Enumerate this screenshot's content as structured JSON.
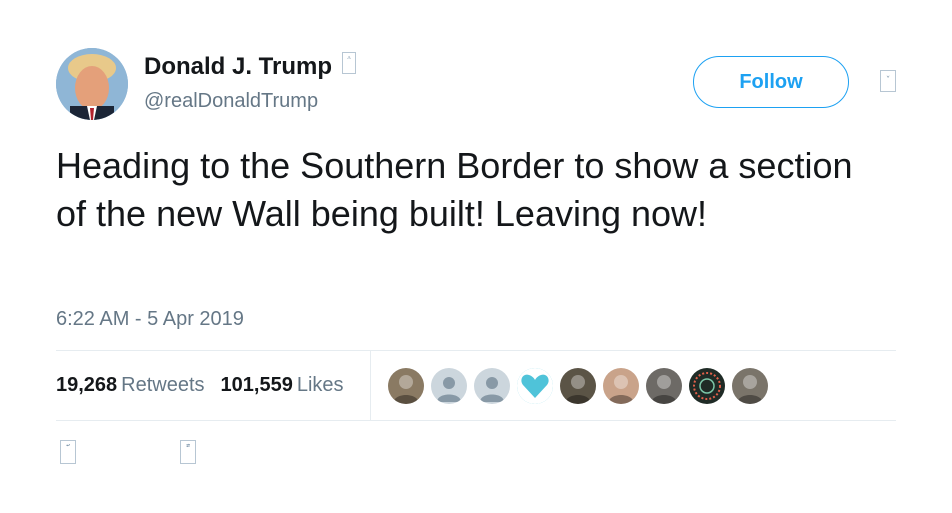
{
  "author": {
    "display_name": "Donald J. Trump",
    "handle": "@realDonaldTrump",
    "verified_glyph": "⚠",
    "avatar_icon": "profile-photo"
  },
  "follow_label": "Follow",
  "menu_glyph": "⌄",
  "tweet": {
    "text": "Heading to the Southern Border to show a section of the new Wall being built! Leaving now!",
    "timestamp": "6:22 AM - 5 Apr 2019"
  },
  "stats": {
    "retweets_count": "19,268",
    "retweets_label": "Retweets",
    "likes_count": "101,559",
    "likes_label": "Likes"
  },
  "likers": [
    {
      "icon": "photo-avatar",
      "color": "#8a7a63"
    },
    {
      "icon": "default-avatar",
      "color": "#ccd6dd"
    },
    {
      "icon": "default-avatar",
      "color": "#ccd6dd"
    },
    {
      "icon": "heart-avatar",
      "color": "#4fc3d9"
    },
    {
      "icon": "photo-avatar",
      "color": "#5b5446"
    },
    {
      "icon": "photo-avatar",
      "color": "#c9a38a"
    },
    {
      "icon": "photo-avatar",
      "color": "#6d6a66"
    },
    {
      "icon": "emblem-avatar",
      "color": "#1f2b26"
    },
    {
      "icon": "photo-avatar",
      "color": "#7a746a"
    }
  ],
  "actions": [
    {
      "icon": "reply-icon",
      "glyph": "↩"
    },
    {
      "icon": "retweet-icon",
      "glyph": "⇄"
    }
  ]
}
